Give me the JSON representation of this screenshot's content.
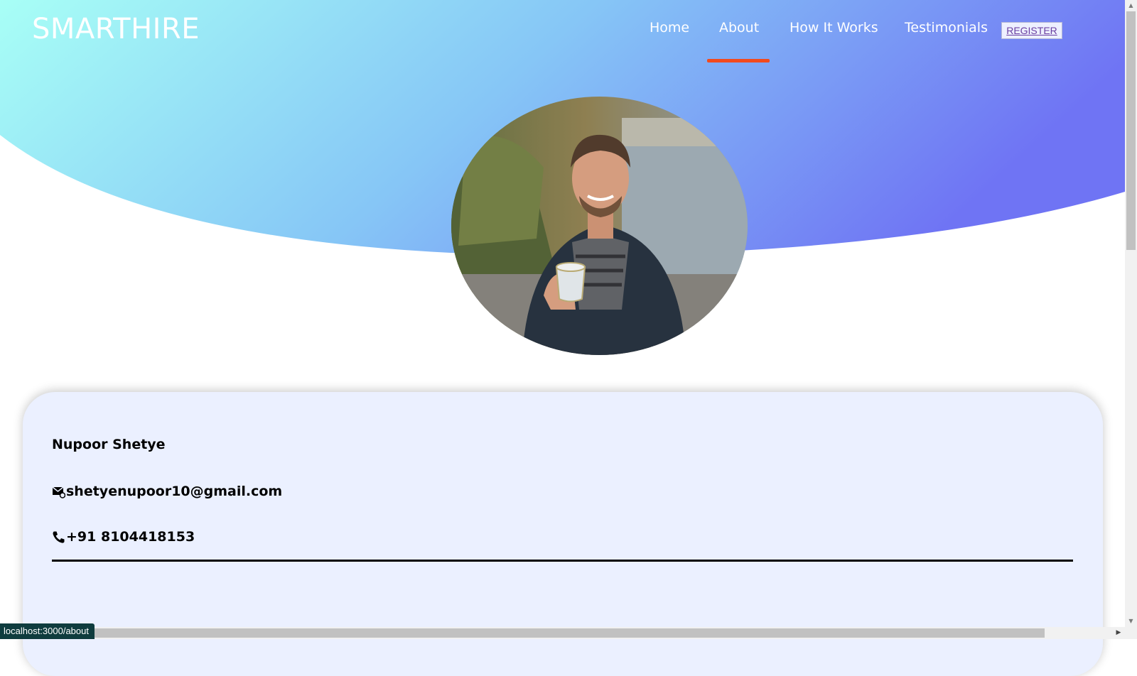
{
  "brand": {
    "logo_text": "SMARTHIRE"
  },
  "nav": {
    "items": [
      {
        "label": "Home",
        "active": false
      },
      {
        "label": "About",
        "active": true
      },
      {
        "label": "How It Works",
        "active": false
      },
      {
        "label": "Testimonials",
        "active": false
      }
    ],
    "register_label": "REGISTER"
  },
  "profile": {
    "name": "Nupoor Shetye",
    "email": "shetyenupoor10@gmail.com",
    "phone": "+91 8104418153",
    "email_icon": "mail-icon",
    "phone_icon": "phone-icon",
    "avatar": "profile-photo"
  },
  "status_bar": {
    "url": "localhost:3000/about"
  },
  "colors": {
    "hero_gradient_start": "#a8fff6",
    "hero_gradient_mid": "#85c7f7",
    "hero_gradient_end": "#6f74f4",
    "active_underline": "#f24a1d",
    "card_background": "#ebf0ff"
  }
}
